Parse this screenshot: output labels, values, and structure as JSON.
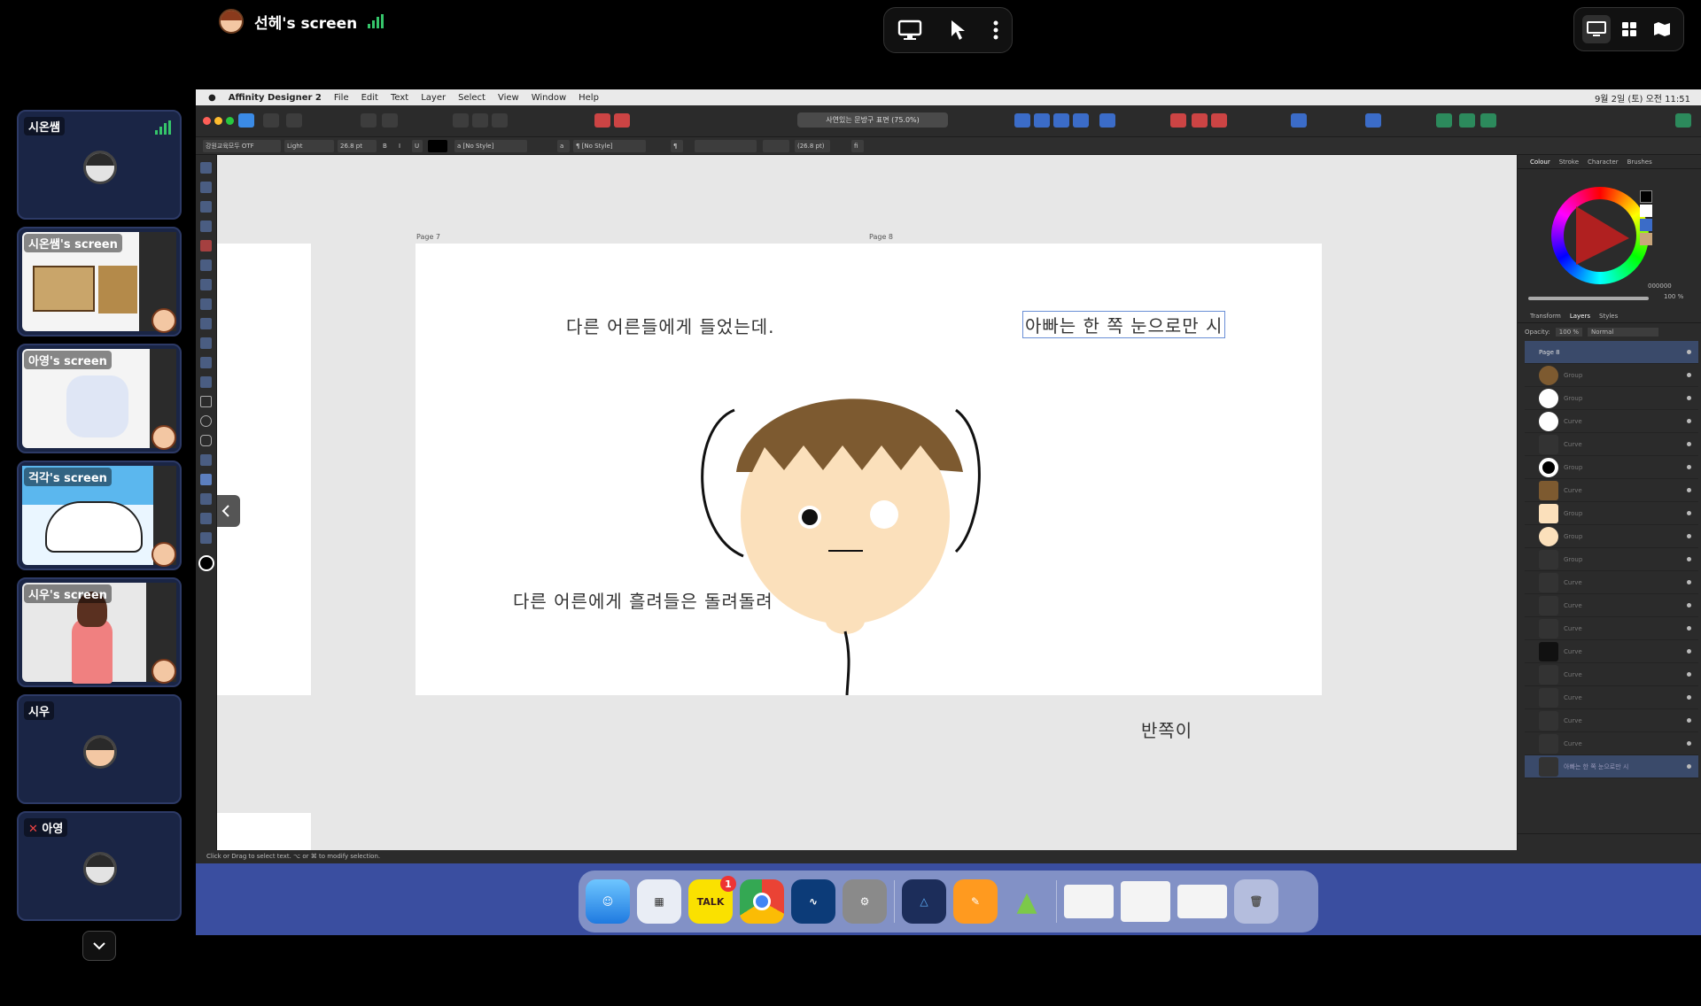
{
  "meeting": {
    "presenter_name": "선헤's screen",
    "view_controls": [
      "monitor-icon",
      "grid-icon",
      "map-icon"
    ],
    "center_controls": [
      "screen-share-icon",
      "pointer-icon",
      "more-icon"
    ]
  },
  "tiles": [
    {
      "label": "시온쌤",
      "type": "avatar"
    },
    {
      "label": "시온쌤's screen",
      "type": "screen"
    },
    {
      "label": "아영's screen",
      "type": "screen"
    },
    {
      "label": "걱각's screen",
      "type": "screen"
    },
    {
      "label": "시우's screen",
      "type": "screen"
    },
    {
      "label": "시우",
      "type": "avatar"
    },
    {
      "label": "아영",
      "type": "avatar",
      "muted": true
    }
  ],
  "app": {
    "menubar": {
      "app_name": "Affinity Designer 2",
      "items": [
        "File",
        "Edit",
        "Text",
        "Layer",
        "Select",
        "View",
        "Window",
        "Help"
      ],
      "datetime": "9월 2일 (토) 오전 11:51"
    },
    "doc_title": "사연있는 문방구 표면 (75.0%)",
    "context": {
      "font": "강원교육모두 OTF",
      "weight": "Light",
      "size": "26.8 pt",
      "style1": "[No Style]",
      "style2": "[No Style]",
      "leading": "(26.8 pt)"
    },
    "page_labels": [
      "Page 7",
      "Page 8"
    ],
    "canvas_text": {
      "line1": "다른 어른들에게 들었는데.",
      "line2": "아빠는 한 쪽 눈으로만 시",
      "line3": "다른 어른에게 흘려들은 돌려돌려",
      "line4": "반쪽이"
    },
    "panel": {
      "tabs_top": [
        "Colour",
        "Stroke",
        "Character",
        "Brushes"
      ],
      "hex": "000000",
      "opacity": "100 %",
      "tabs_layers": [
        "Transform",
        "Layers",
        "Styles"
      ],
      "layer_opacity": "100 %",
      "blend": "Normal",
      "page_layer": "Page 8",
      "layers": [
        "Group",
        "Group",
        "Curve",
        "Curve",
        "Group",
        "Curve",
        "Group",
        "Group",
        "Group",
        "Curve",
        "Curve",
        "Curve",
        "Curve",
        "Curve",
        "Curve",
        "Curve",
        "Curve"
      ],
      "selected_layer": "아빠는 한 쪽 눈으로만 시"
    },
    "status": "Click or Drag to select text. ⌥ or ⌘ to modify selection."
  },
  "dock": {
    "apps": [
      "Finder",
      "Launchpad",
      "KakaoTalk",
      "Chrome",
      "Mercury",
      "System Settings",
      "Affinity Designer",
      "Pages",
      "Android Studio"
    ],
    "kakao_badge": "1",
    "talk_label": "TALK"
  },
  "colors": {
    "accent": "#35c46a",
    "tile_bg": "#1a2545",
    "app_bg": "#2b2b2b"
  }
}
